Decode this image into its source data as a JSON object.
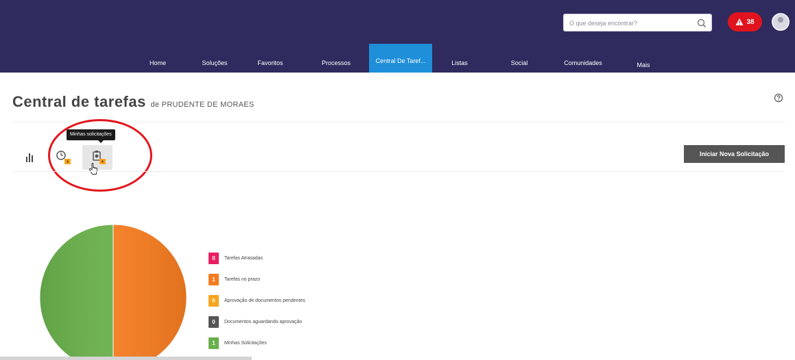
{
  "header": {
    "search_placeholder": "O que deseja encontrar?",
    "alerts_count": "38"
  },
  "nav": {
    "items": [
      {
        "label": "Home"
      },
      {
        "label": "Soluções"
      },
      {
        "label": "Favoritos"
      },
      {
        "label": "Processos"
      },
      {
        "label": "Central De Taref..."
      },
      {
        "label": "Listas"
      },
      {
        "label": "Social"
      },
      {
        "label": "Comunidades"
      },
      {
        "label": "Mais"
      }
    ],
    "active_index": 4
  },
  "page": {
    "title": "Central de tarefas",
    "subtitle": "de PRUDENTE DE MORAES"
  },
  "toolbar": {
    "tooltip": "Minhas solicitações",
    "new_request_label": "Iniciar Nova Solicitação"
  },
  "colors": {
    "header_bg": "#2f2b5e",
    "nav_active": "#1f8fd9",
    "alert_red": "#e0141e",
    "late": "#e91e63",
    "on_time": "#f47b20",
    "approval_pending": "#f7a51c",
    "awaiting_approval": "#555555",
    "my_requests": "#6ab04c"
  },
  "chart_data": {
    "type": "pie",
    "categories": [
      "Tarefas Atrasadas",
      "Tarefas no prazo",
      "Aprovação de documentos pendentes",
      "Documentos aguardando aprovação",
      "Minhas Solicitações"
    ],
    "values": [
      0,
      1,
      0,
      0,
      1
    ],
    "colors": [
      "#e91e63",
      "#f47b20",
      "#f7a51c",
      "#555555",
      "#6ab04c"
    ],
    "legend_placement": "right",
    "value_labels": [
      "0",
      "1",
      "0",
      "0",
      "1"
    ]
  }
}
